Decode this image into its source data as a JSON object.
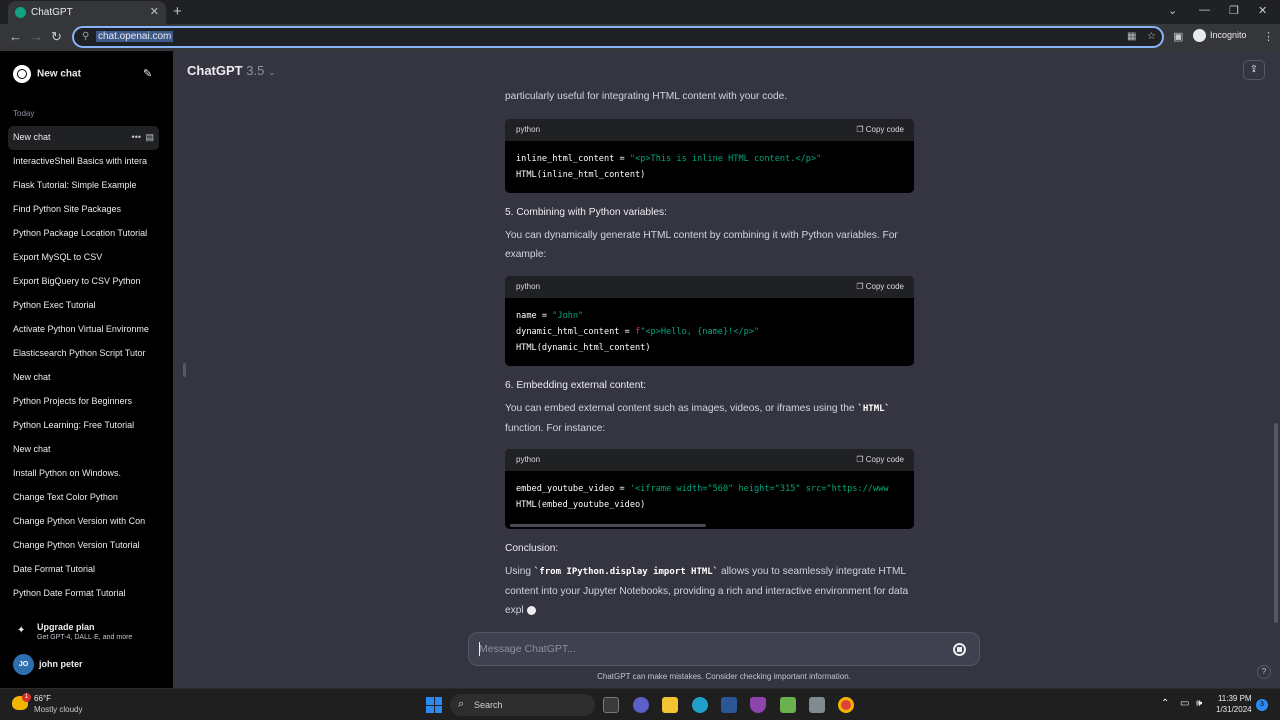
{
  "browser": {
    "tab_title": "ChatGPT",
    "url": "chat.openai.com",
    "incognito_label": "Incognito"
  },
  "sidebar": {
    "new_chat": "New chat",
    "section": "Today",
    "items": [
      "New chat",
      "InteractiveShell Basics with intera",
      "Flask Tutorial: Simple Example",
      "Find Python Site Packages",
      "Python Package Location Tutorial",
      "Export MySQL to CSV",
      "Export BigQuery to CSV Python",
      "Python Exec Tutorial",
      "Activate Python Virtual Environme",
      "Elasticsearch Python Script Tutor",
      "New chat",
      "Python Projects for Beginners",
      "Python Learning: Free Tutorial",
      "New chat",
      "Install Python on Windows.",
      "Change Text Color Python",
      "Change Python Version with Con",
      "Change Python Version Tutorial",
      "Date Format Tutorial",
      "Python Date Format Tutorial"
    ],
    "upgrade_title": "Upgrade plan",
    "upgrade_sub": "Get GPT-4, DALL·E, and more",
    "user_initials": "JO",
    "user_name": "john peter"
  },
  "header": {
    "model": "ChatGPT",
    "version": "3.5"
  },
  "content": {
    "intro": "particularly useful for integrating HTML content with your code.",
    "code_lang": "python",
    "copy_label": "Copy code",
    "code1": {
      "l1_var": "inline_html_content = ",
      "l1_str": "\"<p>This is inline HTML content.</p>\"",
      "l2": "HTML(inline_html_content)"
    },
    "h5": "5. Combining with Python variables:",
    "p5": "You can dynamically generate HTML content by combining it with Python variables. For example:",
    "code2": {
      "l1_var": "name = ",
      "l1_str": "\"John\"",
      "l2_var": "dynamic_html_content = ",
      "l2_kw": "f",
      "l2_str": "\"<p>Hello, {name}!</p>\"",
      "l3": "HTML(dynamic_html_content)"
    },
    "h6": "6. Embedding external content:",
    "p6_a": "You can embed external content such as images, videos, or iframes using the ",
    "p6_code": "`HTML`",
    "p6_b": " function. For instance:",
    "code3": {
      "l1_var": "embed_youtube_video = ",
      "l1_str": "'<iframe width=\"560\" height=\"315\" src=\"https://www",
      "l2": "HTML(embed_youtube_video)"
    },
    "conclusion_h": "Conclusion:",
    "conclusion_a": "Using ",
    "conclusion_code": "`from IPython.display import HTML`",
    "conclusion_b": " allows you to seamlessly integrate HTML content into your Jupyter Notebooks, providing a rich and interactive environment for data expl"
  },
  "composer": {
    "placeholder": "Message ChatGPT...",
    "disclaimer": "ChatGPT can make mistakes. Consider checking important information.",
    "help": "?"
  },
  "taskbar": {
    "temp": "66°F",
    "weather": "Mostly cloudy",
    "weather_badge": "1",
    "search": "Search",
    "time": "11:39 PM",
    "date": "1/31/2024",
    "notif": "3"
  }
}
